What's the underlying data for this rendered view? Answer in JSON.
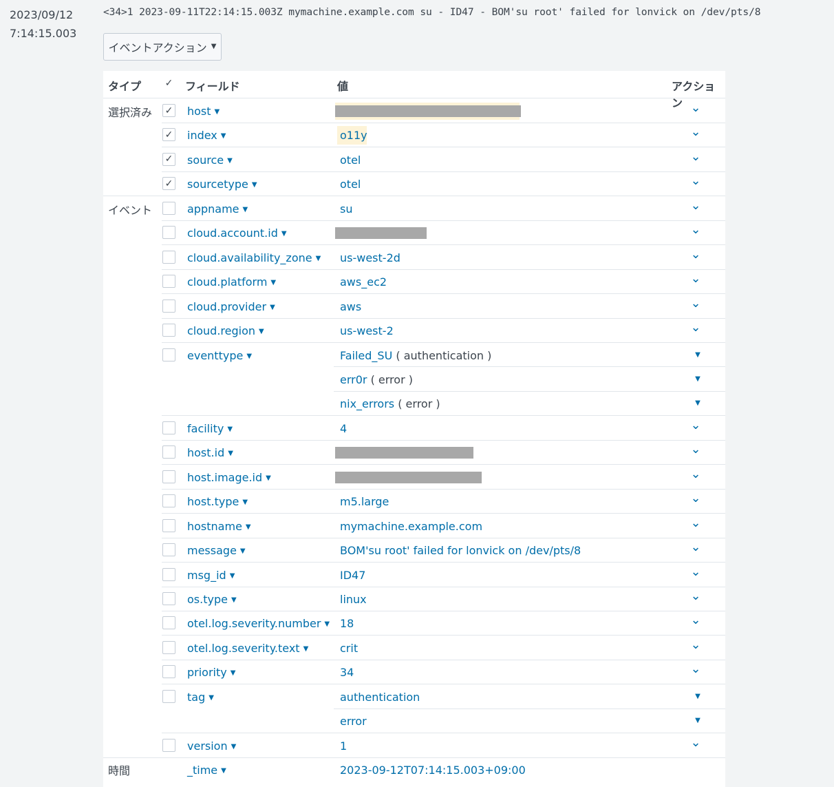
{
  "event": {
    "date": "2023/09/12",
    "time": "7:14:15.003",
    "raw": "<34>1 2023-09-11T22:14:15.003Z mymachine.example.com su - ID47 - BOM'su root' failed for lonvick on /dev/pts/8",
    "actions_button": "イベントアクション"
  },
  "table": {
    "headers": {
      "type": "タイプ",
      "field": "フィールド",
      "value": "値",
      "action": "アクション"
    },
    "groups": {
      "selected": "選択済み",
      "event": "イベント",
      "time": "時間"
    },
    "rows": [
      {
        "field": "host",
        "value": "",
        "checked": true,
        "redacted": true
      },
      {
        "field": "index",
        "value": "o11y",
        "checked": true,
        "highlight": true
      },
      {
        "field": "source",
        "value": "otel",
        "checked": true
      },
      {
        "field": "sourcetype",
        "value": "otel",
        "checked": true
      },
      {
        "field": "appname",
        "value": "su",
        "checked": false
      },
      {
        "field": "cloud.account.id",
        "value": "",
        "checked": false,
        "redacted": true
      },
      {
        "field": "cloud.availability_zone",
        "value": "us-west-2d",
        "checked": false
      },
      {
        "field": "cloud.platform",
        "value": "aws_ec2",
        "checked": false
      },
      {
        "field": "cloud.provider",
        "value": "aws",
        "checked": false
      },
      {
        "field": "cloud.region",
        "value": "us-west-2",
        "checked": false
      },
      {
        "field": "eventtype",
        "value": "Failed_SU",
        "tag": "authentication",
        "checked": false
      },
      {
        "field": "",
        "value": "err0r",
        "tag": "error",
        "checked": null
      },
      {
        "field": "",
        "value": "nix_errors",
        "tag": "error",
        "checked": null
      },
      {
        "field": "facility",
        "value": "4",
        "checked": false
      },
      {
        "field": "host.id",
        "value": "",
        "checked": false,
        "redacted": true
      },
      {
        "field": "host.image.id",
        "value": "",
        "checked": false,
        "redacted": true
      },
      {
        "field": "host.type",
        "value": "m5.large",
        "checked": false
      },
      {
        "field": "hostname",
        "value": "mymachine.example.com",
        "checked": false
      },
      {
        "field": "message",
        "value": "BOM'su root' failed for lonvick on /dev/pts/8",
        "checked": false
      },
      {
        "field": "msg_id",
        "value": "ID47",
        "checked": false
      },
      {
        "field": "os.type",
        "value": "linux",
        "checked": false
      },
      {
        "field": "otel.log.severity.number",
        "value": "18",
        "checked": false
      },
      {
        "field": "otel.log.severity.text",
        "value": "crit",
        "checked": false
      },
      {
        "field": "priority",
        "value": "34",
        "checked": false
      },
      {
        "field": "tag",
        "value": "authentication",
        "checked": false
      },
      {
        "field": "",
        "value": "error",
        "checked": null
      },
      {
        "field": "version",
        "value": "1",
        "checked": false
      },
      {
        "field": "_time",
        "value": "2023-09-12T07:14:15.003+09:00",
        "checked": null
      }
    ]
  },
  "icons": {
    "chevron": "chevron-down-icon",
    "caret": "caret-down-icon",
    "check": "check-icon"
  }
}
